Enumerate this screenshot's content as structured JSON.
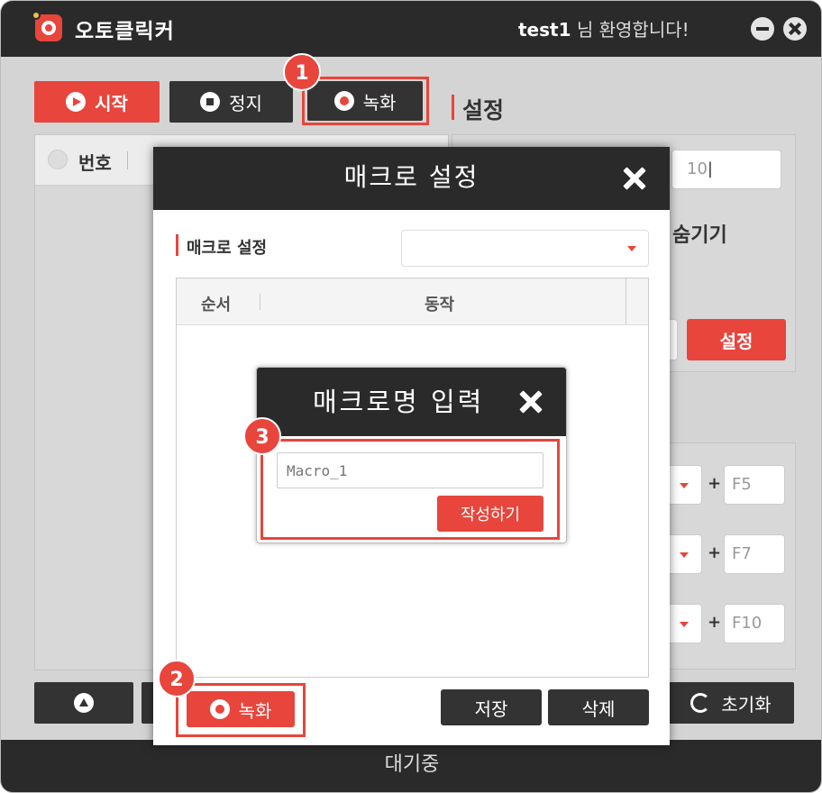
{
  "app": {
    "title": "오토클릭커",
    "user": "test1",
    "welcome_rest": " 님 환영합니다!"
  },
  "toolbar": {
    "start_label": "시작",
    "stop_label": "정지",
    "record_label": "녹화"
  },
  "settings": {
    "title": "설정",
    "input_value": "10",
    "hide_label": "숨기기",
    "set_button": "설정",
    "reset_label": "초기화"
  },
  "list": {
    "number_header": "번호"
  },
  "hotkeys": [
    {
      "key": "F5"
    },
    {
      "key": "F7"
    },
    {
      "key": "F10"
    }
  ],
  "macro_modal": {
    "title": "매크로 설정",
    "section_label": "매크로 설정",
    "columns": {
      "order": "순서",
      "action": "동작"
    },
    "record_button": "녹화",
    "save_button": "저장",
    "delete_button": "삭제"
  },
  "name_modal": {
    "title": "매크로명 입력",
    "placeholder": "Macro_1",
    "create_button": "작성하기"
  },
  "status": {
    "text": "대기중"
  },
  "callouts": [
    "1",
    "2",
    "3"
  ],
  "colors": {
    "accent": "#e8453c",
    "dark": "#2a2a2a",
    "background": "#d4d4d4"
  }
}
